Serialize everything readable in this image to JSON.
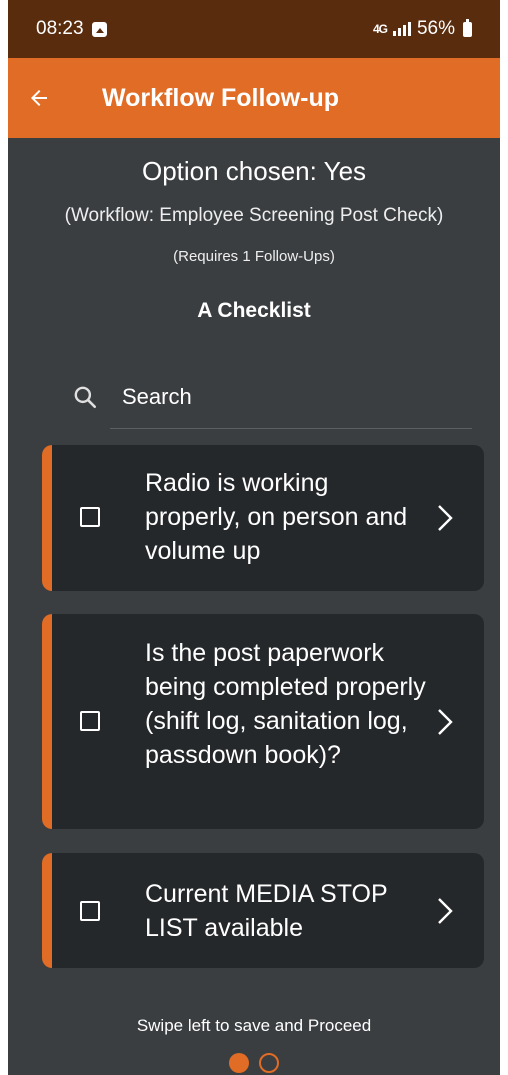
{
  "status_bar": {
    "time": "08:23",
    "network": "4G",
    "battery": "56%"
  },
  "app_bar": {
    "title": "Workflow Follow-up"
  },
  "header": {
    "option_chosen": "Option chosen: Yes",
    "workflow": "(Workflow: Employee Screening Post Check)",
    "requires": "(Requires 1 Follow-Ups)",
    "checklist_title": "A Checklist"
  },
  "search": {
    "placeholder": "Search"
  },
  "items": [
    {
      "label": "Radio is working properly, on person and volume up"
    },
    {
      "label": "Is the post paperwork being completed properly (shift log, sanitation log, passdown book)?"
    },
    {
      "label": "Current MEDIA STOP LIST available"
    }
  ],
  "footer": {
    "swipe_hint": "Swipe left to save and Proceed"
  },
  "colors": {
    "accent": "#e06c25",
    "status_bar": "#5a2c0e",
    "background": "#3a3e41",
    "card": "#25282a"
  },
  "icons": [
    "back-arrow-icon",
    "search-icon",
    "checkbox-icon",
    "chevron-right-icon"
  ]
}
